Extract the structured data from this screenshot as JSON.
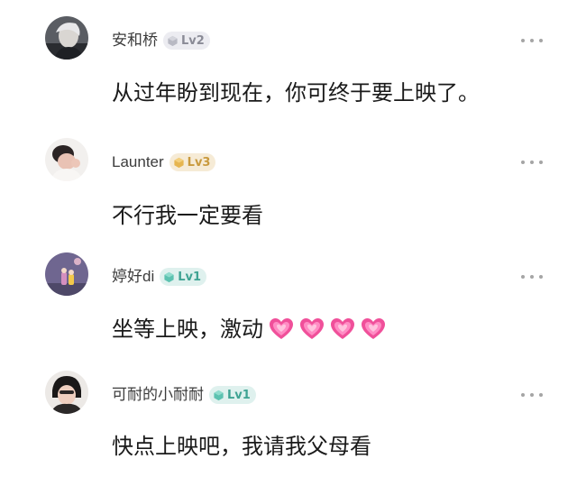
{
  "comments": [
    {
      "username": "安和桥",
      "level": "Lv2",
      "text": "从过年盼到现在，你可终于要上映了。",
      "emoji_count": 0
    },
    {
      "username": "Launter",
      "level": "Lv3",
      "text": "不行我一定要看",
      "emoji_count": 0
    },
    {
      "username": "婷好di",
      "level": "Lv1",
      "text": "坐等上映，激动",
      "emoji_count": 4,
      "emoji_icon": "pink-heart-emoji"
    },
    {
      "username": "可耐的小耐耐",
      "level": "Lv1",
      "text": "快点上映吧，我请我父母看",
      "emoji_count": 0
    }
  ],
  "colors": {
    "lv1": "#3fa393",
    "lv2": "#8a8b96",
    "lv3": "#c99a3e",
    "more_dots": "#a5a5a5",
    "heart": "#f0509a"
  },
  "icons": {
    "more": "more-dots-icon",
    "level": "hexagon-level-icon"
  }
}
